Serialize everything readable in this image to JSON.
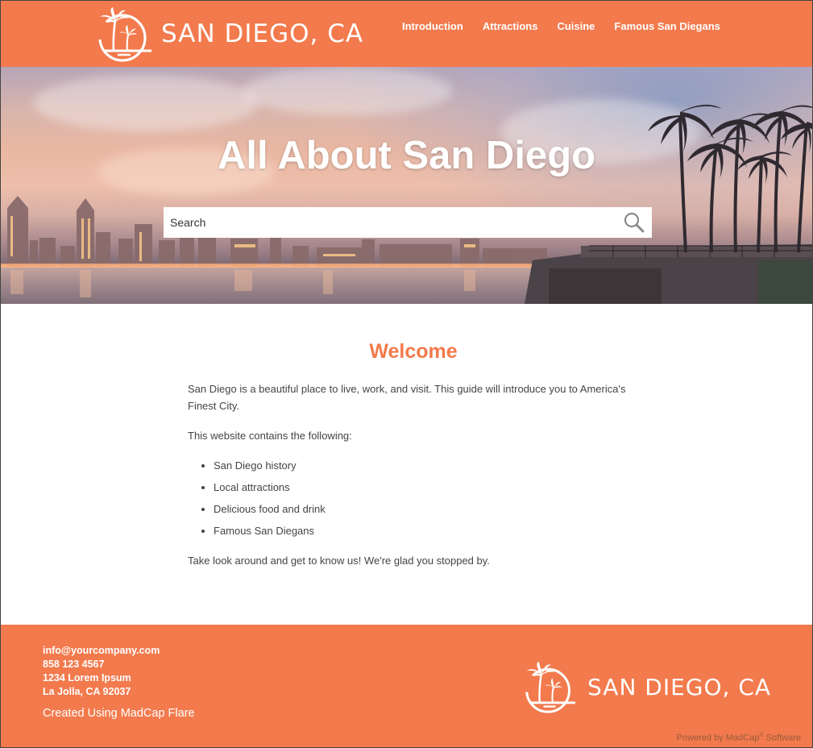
{
  "header": {
    "logo_text": "SAN DIEGO, CA",
    "nav": [
      "Introduction",
      "Attractions",
      "Cuisine",
      "Famous San Diegans"
    ]
  },
  "hero": {
    "title": "All About San Diego",
    "search_placeholder": "Search"
  },
  "main": {
    "heading": "Welcome",
    "intro": "San Diego is a beautiful place to live, work, and visit. This guide will introduce you to America's Finest City.",
    "contains": "This website contains the following:",
    "list": [
      "San Diego history",
      "Local attractions",
      "Delicious food and drink",
      "Famous San Diegans"
    ],
    "closing": "Take look around and get to know us! We're glad you stopped by."
  },
  "footer": {
    "email": "info@yourcompany.com",
    "phone": "858 123 4567",
    "address1": "1234 Lorem Ipsum",
    "address2": "La Jolla, CA 92037",
    "created": "Created Using MadCap Flare",
    "logo_text": "SAN DIEGO, CA",
    "powered_prefix": "Powered by MadCap",
    "powered_mark": "®",
    "powered_suffix": " Software"
  },
  "colors": {
    "brand": "#f27a4d",
    "text": "#444444"
  }
}
